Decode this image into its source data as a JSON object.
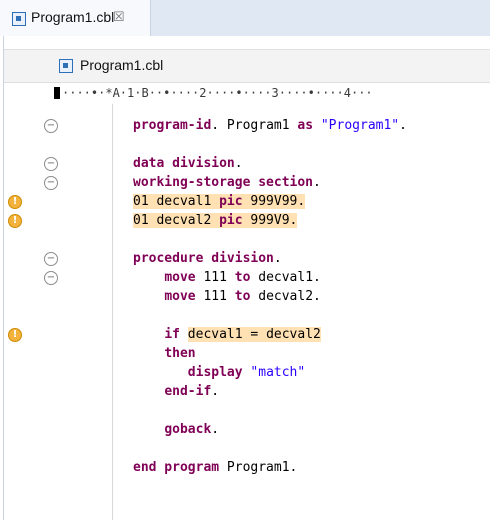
{
  "tab": {
    "label": "Program1.cbl",
    "close": "☒",
    "icon": "cobol-file-icon"
  },
  "breadcrumb": {
    "label": "Program1.cbl",
    "icon": "cobol-file-icon"
  },
  "ruler": {
    "text": "····•·*A·1·B··•····2····•····3····•····4···"
  },
  "code": {
    "lines": [
      {
        "parts": [
          {
            "t": "program-id",
            "c": "kw"
          },
          {
            "t": ". Program1 "
          },
          {
            "t": "as",
            "c": "kw"
          },
          {
            "t": " "
          },
          {
            "t": "\"Program1\"",
            "c": "str"
          },
          {
            "t": "."
          }
        ]
      },
      {
        "parts": []
      },
      {
        "parts": [
          {
            "t": "data division",
            "c": "kw"
          },
          {
            "t": "."
          }
        ]
      },
      {
        "parts": [
          {
            "t": "working-storage section",
            "c": "kw"
          },
          {
            "t": "."
          }
        ]
      },
      {
        "hl": true,
        "parts": [
          {
            "t": "01 decval1 "
          },
          {
            "t": "pic",
            "c": "kw"
          },
          {
            "t": " 999V99."
          }
        ]
      },
      {
        "hl": true,
        "parts": [
          {
            "t": "01 decval2 "
          },
          {
            "t": "pic",
            "c": "kw"
          },
          {
            "t": " 999V9."
          }
        ]
      },
      {
        "parts": []
      },
      {
        "parts": [
          {
            "t": "procedure division",
            "c": "kw"
          },
          {
            "t": "."
          }
        ]
      },
      {
        "parts": [
          {
            "t": "    "
          },
          {
            "t": "move",
            "c": "kw"
          },
          {
            "t": " 111 "
          },
          {
            "t": "to",
            "c": "kw"
          },
          {
            "t": " decval1."
          }
        ]
      },
      {
        "parts": [
          {
            "t": "    "
          },
          {
            "t": "move",
            "c": "kw"
          },
          {
            "t": " 111 "
          },
          {
            "t": "to",
            "c": "kw"
          },
          {
            "t": " decval2."
          }
        ]
      },
      {
        "parts": []
      },
      {
        "parts": [
          {
            "t": "    "
          },
          {
            "t": "if",
            "c": "kw"
          },
          {
            "t": " "
          },
          {
            "t": "decval1 = decval2",
            "hl": true
          }
        ]
      },
      {
        "parts": [
          {
            "t": "    "
          },
          {
            "t": "then",
            "c": "kw"
          }
        ]
      },
      {
        "parts": [
          {
            "t": "       "
          },
          {
            "t": "display",
            "c": "kw"
          },
          {
            "t": " "
          },
          {
            "t": "\"match\"",
            "c": "str"
          }
        ]
      },
      {
        "parts": [
          {
            "t": "    "
          },
          {
            "t": "end-if",
            "c": "kw"
          },
          {
            "t": "."
          }
        ]
      },
      {
        "parts": []
      },
      {
        "parts": [
          {
            "t": "    "
          },
          {
            "t": "goback",
            "c": "kw"
          },
          {
            "t": "."
          }
        ]
      },
      {
        "parts": []
      },
      {
        "parts": [
          {
            "t": "end program",
            "c": "kw"
          },
          {
            "t": " Program1."
          }
        ]
      }
    ]
  },
  "gutter": {
    "fold_symbol": "−",
    "warning_symbol": "!",
    "markers": [
      {
        "type": "fold",
        "line": 0
      },
      {
        "type": "fold",
        "line": 2
      },
      {
        "type": "fold",
        "line": 3
      },
      {
        "type": "warning",
        "line": 4
      },
      {
        "type": "warning",
        "line": 5
      },
      {
        "type": "fold",
        "line": 7
      },
      {
        "type": "fold",
        "line": 8
      },
      {
        "type": "warning",
        "line": 11
      }
    ]
  },
  "colors": {
    "keyword": "#7f0055",
    "string": "#2a00ff",
    "highlight": "#ffe1b3",
    "warning": "#f2b23c"
  }
}
